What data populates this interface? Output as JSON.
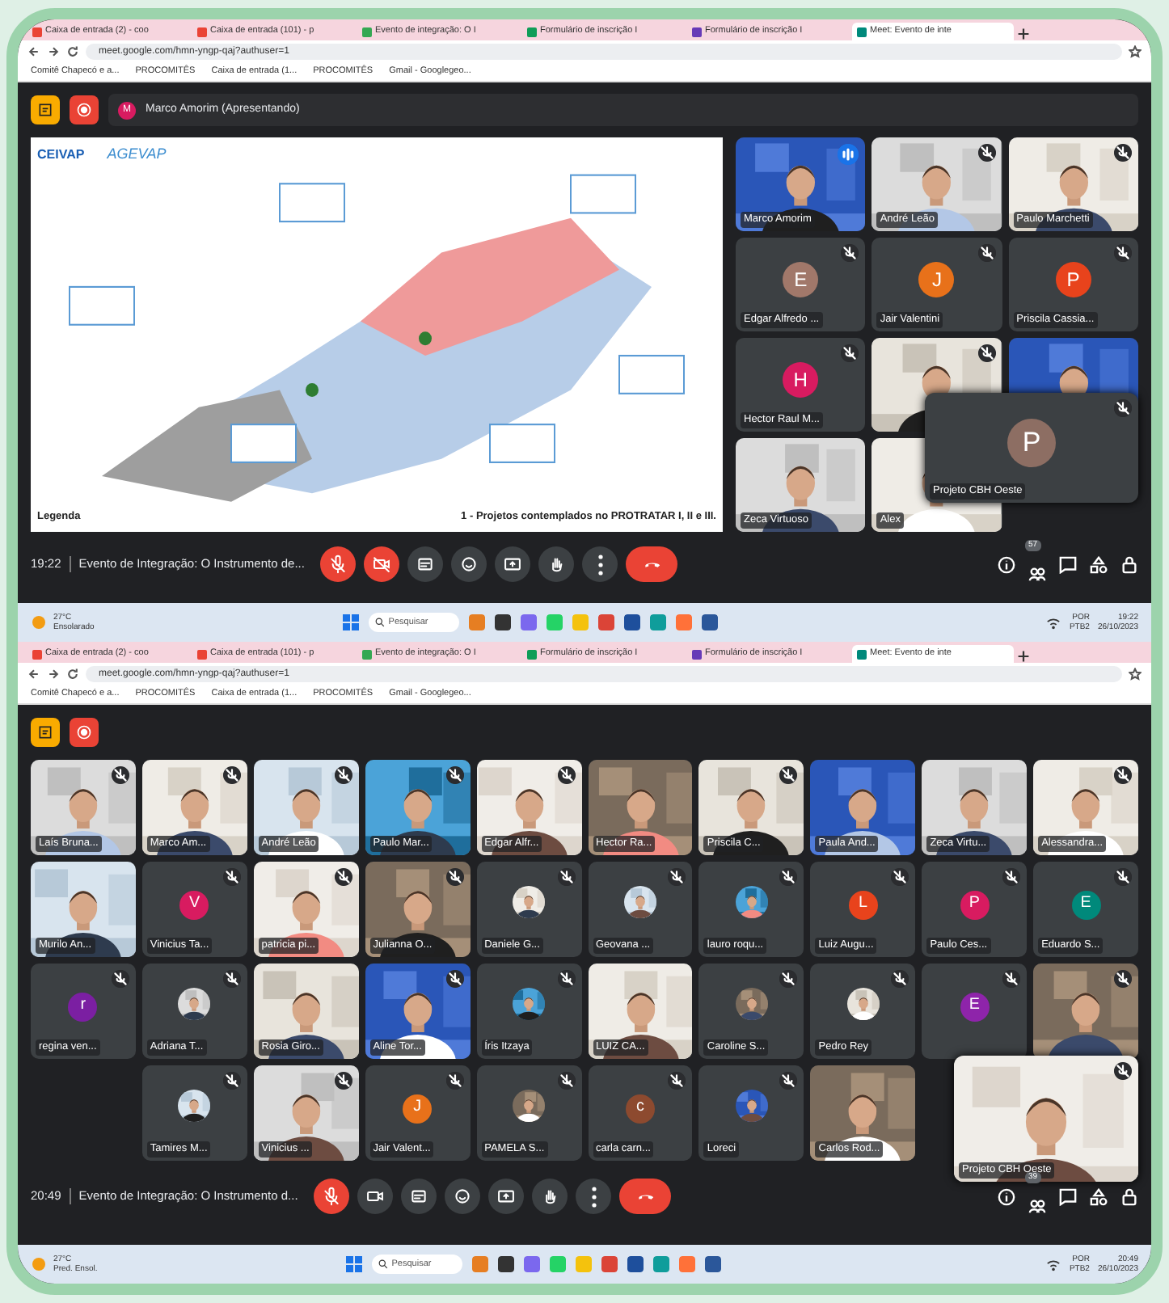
{
  "screens": [
    {
      "browser": {
        "tabs": [
          {
            "label": "Caixa de entrada (2) - coo",
            "selected": false
          },
          {
            "label": "Caixa de entrada (101) - p",
            "selected": false
          },
          {
            "label": "Evento de integração: O I",
            "selected": false
          },
          {
            "label": "Formulário de inscrição I",
            "selected": false
          },
          {
            "label": "Formulário de inscrição I",
            "selected": false
          },
          {
            "label": "Meet: Evento de inte",
            "selected": true
          }
        ],
        "url": "meet.google.com/hmn-yngp-qaj?authuser=1",
        "bookmarks": [
          "Comitê Chapecó e a...",
          "PROCOMITÊS",
          "Caixa de entrada (1...",
          "PROCOMITÊS",
          "Gmail - Googlegeo..."
        ]
      },
      "meet": {
        "presenter": {
          "initial": "M",
          "label": "Marco Amorim (Apresentando)"
        },
        "slide": {
          "logos": [
            "CEIVAP",
            "AGEVAP"
          ],
          "legend_title": "Legenda",
          "caption": "1 - Projetos contemplados no PROTRATAR I, II e III."
        },
        "tiles": [
          {
            "kind": "video",
            "name": "Marco Amorim",
            "muted": false,
            "speaking": true
          },
          {
            "kind": "video",
            "name": "André Leão",
            "muted": true,
            "speaking": false
          },
          {
            "kind": "video",
            "name": "Paulo Marchetti",
            "muted": true,
            "speaking": false
          },
          {
            "kind": "avatar",
            "name": "Edgar Alfredo ...",
            "initial": "E",
            "color": "#a1786a",
            "muted": true,
            "speaking": false
          },
          {
            "kind": "avatar",
            "name": "Jair Valentini",
            "initial": "J",
            "color": "#e8711a",
            "muted": true,
            "speaking": false
          },
          {
            "kind": "avatar",
            "name": "Priscila Cassia...",
            "initial": "P",
            "color": "#e8431c",
            "muted": true,
            "speaking": false
          },
          {
            "kind": "avatar",
            "name": "Hector Raul M...",
            "initial": "H",
            "color": "#d81b60",
            "muted": true,
            "speaking": false
          },
          {
            "kind": "video",
            "muted": true,
            "speaking": false
          },
          {
            "kind": "video",
            "muted": false,
            "speaking": false
          },
          {
            "kind": "video",
            "name": "Zeca Virtuoso",
            "muted": false,
            "speaking": false
          },
          {
            "kind": "video",
            "name": "Alex",
            "muted": false,
            "speaking": false
          },
          {
            "kind": "empty"
          }
        ],
        "floating": {
          "initial": "P",
          "color": "#8d6e63",
          "name": "Projeto CBH Oeste",
          "muted": true
        },
        "bar": {
          "time": "19:22",
          "title": "Evento de Integração: O Instrumento de...",
          "camera_off": true,
          "people_count": "57"
        }
      },
      "taskbar": {
        "temp": "27°C",
        "weather": "Ensolarado",
        "search": "Pesquisar",
        "lang": "POR",
        "layout": "PTB2",
        "time": "19:22",
        "date": "26/10/2023"
      }
    },
    {
      "browser": {
        "tabs": [
          {
            "label": "Caixa de entrada (2) - coo",
            "selected": false
          },
          {
            "label": "Caixa de entrada (101) - p",
            "selected": false
          },
          {
            "label": "Evento de integração: O I",
            "selected": false
          },
          {
            "label": "Formulário de inscrição I",
            "selected": false
          },
          {
            "label": "Formulário de inscrição I",
            "selected": false
          },
          {
            "label": "Meet: Evento de inte",
            "selected": true
          }
        ],
        "url": "meet.google.com/hmn-yngp-qaj?authuser=1",
        "bookmarks": [
          "Comitê Chapecó e a...",
          "PROCOMITÊS",
          "Caixa de entrada (1...",
          "PROCOMITÊS",
          "Gmail - Googlegeo..."
        ]
      },
      "meet": {
        "tiles": [
          {
            "kind": "video",
            "name": "Laís Bruna...",
            "muted": true
          },
          {
            "kind": "video",
            "name": "Marco Am...",
            "muted": true
          },
          {
            "kind": "video",
            "name": "André Leão",
            "muted": true
          },
          {
            "kind": "video",
            "name": "Paulo Mar...",
            "muted": true
          },
          {
            "kind": "video",
            "name": "Edgar Alfr...",
            "muted": true
          },
          {
            "kind": "video",
            "name": "Hector Ra...",
            "muted": false
          },
          {
            "kind": "video",
            "name": "Priscila C...",
            "muted": true
          },
          {
            "kind": "video",
            "name": "Paula And...",
            "muted": false
          },
          {
            "kind": "video",
            "name": "Zeca Virtu...",
            "muted": false
          },
          {
            "kind": "video",
            "name": "Alessandra...",
            "muted": true
          },
          {
            "kind": "video",
            "name": "Murilo An...",
            "muted": false
          },
          {
            "kind": "avatar",
            "name": "Vinicius Ta...",
            "initial": "V",
            "color": "#d81b60",
            "muted": true
          },
          {
            "kind": "video",
            "name": "patricia pi...",
            "muted": true
          },
          {
            "kind": "video",
            "name": "Julianna O...",
            "muted": true
          },
          {
            "kind": "photo_avatar",
            "name": "Daniele G...",
            "muted": true
          },
          {
            "kind": "photo_avatar",
            "name": "Geovana ...",
            "muted": true
          },
          {
            "kind": "photo_avatar",
            "name": "lauro roqu...",
            "muted": true
          },
          {
            "kind": "avatar",
            "name": "Luiz Augu...",
            "initial": "L",
            "color": "#e8431c",
            "muted": true
          },
          {
            "kind": "avatar",
            "name": "Paulo Ces...",
            "initial": "P",
            "color": "#d81b60",
            "muted": true
          },
          {
            "kind": "avatar",
            "name": "Eduardo S...",
            "initial": "E",
            "color": "#00897b",
            "muted": true
          },
          {
            "kind": "avatar",
            "name": "regina ven...",
            "initial": "r",
            "color": "#7b1fa2",
            "muted": true
          },
          {
            "kind": "photo_avatar",
            "name": "Adriana T...",
            "muted": true
          },
          {
            "kind": "video",
            "name": "Rosia Giro...",
            "muted": false
          },
          {
            "kind": "video",
            "name": "Aline Tor...",
            "muted": true
          },
          {
            "kind": "photo_avatar",
            "name": "Íris Itzaya",
            "muted": true
          },
          {
            "kind": "video",
            "name": "LUIZ CA...",
            "muted": false
          },
          {
            "kind": "photo_avatar",
            "name": "Caroline S...",
            "muted": true
          },
          {
            "kind": "photo_avatar",
            "name": "Pedro Rey",
            "muted": true
          },
          {
            "kind": "avatar",
            "initial": "E",
            "color": "#8e24aa",
            "muted": true
          },
          {
            "kind": "video",
            "muted": true
          },
          {
            "kind": "empty"
          },
          {
            "kind": "photo_avatar",
            "name": "Tamires M...",
            "muted": true
          },
          {
            "kind": "video",
            "name": "Vinicius ...",
            "muted": true
          },
          {
            "kind": "avatar",
            "name": "Jair Valent...",
            "initial": "J",
            "color": "#e8711a",
            "muted": true
          },
          {
            "kind": "photo_avatar",
            "name": "PAMELA S...",
            "muted": true
          },
          {
            "kind": "avatar",
            "name": "carla carn...",
            "initial": "c",
            "color": "#8d4a2f",
            "muted": true
          },
          {
            "kind": "photo_avatar",
            "name": "Loreci",
            "muted": true
          },
          {
            "kind": "video",
            "name": "Carlos Rod...",
            "muted": false
          }
        ],
        "self_view": {
          "name": "Projeto CBH Oeste",
          "muted": true
        },
        "bar": {
          "time": "20:49",
          "title": "Evento de Integração: O Instrumento d...",
          "camera_off": false,
          "people_count": "39"
        }
      },
      "taskbar": {
        "temp": "27°C",
        "weather": "Pred. Ensol.",
        "search": "Pesquisar",
        "lang": "POR",
        "layout": "PTB2",
        "time": "20:49",
        "date": "26/10/2023"
      }
    }
  ]
}
